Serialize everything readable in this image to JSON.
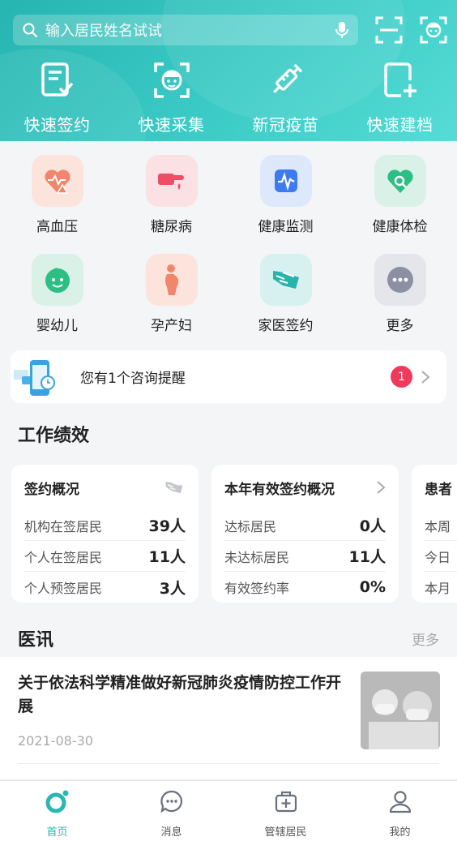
{
  "search": {
    "placeholder": "输入居民姓名试试",
    "icon": "search-icon",
    "mic_icon": "microphone-icon"
  },
  "header_icons": [
    "scan-icon",
    "face-scan-icon"
  ],
  "quick_actions": [
    {
      "label": "快速签约",
      "icon": "sign-document-icon"
    },
    {
      "label": "快速采集",
      "icon": "face-capture-icon"
    },
    {
      "label": "新冠疫苗",
      "icon": "vaccine-syringe-icon"
    },
    {
      "label": "快速建档",
      "icon": "new-file-icon"
    }
  ],
  "services": [
    {
      "label": "高血压",
      "icon": "heart-alert-icon",
      "tile_color": "#fce4dc"
    },
    {
      "label": "糖尿病",
      "icon": "finger-blood-icon",
      "tile_color": "#fbe0e4"
    },
    {
      "label": "健康监测",
      "icon": "heartbeat-monitor-icon",
      "tile_color": "#dde8fb"
    },
    {
      "label": "健康体检",
      "icon": "heart-search-icon",
      "tile_color": "#d9f1e6"
    },
    {
      "label": "婴幼儿",
      "icon": "baby-face-icon",
      "tile_color": "#d9f1e6"
    },
    {
      "label": "孕产妇",
      "icon": "pregnant-woman-icon",
      "tile_color": "#fce4dc"
    },
    {
      "label": "家医签约",
      "icon": "handshake-contract-icon",
      "tile_color": "#d6f1ef"
    },
    {
      "label": "更多",
      "icon": "more-dots-icon",
      "tile_color": "#e4e6ec"
    }
  ],
  "reminder": {
    "text": "您有1个咨询提醒",
    "badge": "1"
  },
  "performance": {
    "title": "工作绩效",
    "cards": [
      {
        "title": "签约概况",
        "rows": [
          {
            "label": "机构在签居民",
            "value": "39人"
          },
          {
            "label": "个人在签居民",
            "value": "11人"
          },
          {
            "label": "个人预签居民",
            "value": "3人"
          }
        ]
      },
      {
        "title": "本年有效签约概况",
        "rows": [
          {
            "label": "达标居民",
            "value": "0人"
          },
          {
            "label": "未达标居民",
            "value": "11人"
          },
          {
            "label": "有效签约率",
            "value": "0%"
          }
        ]
      },
      {
        "title": "患者",
        "rows": [
          {
            "label": "本周",
            "value": ""
          },
          {
            "label": "今日",
            "value": ""
          },
          {
            "label": "本月",
            "value": ""
          }
        ]
      }
    ]
  },
  "news": {
    "title": "医讯",
    "more": "更多",
    "items": [
      {
        "title": "关于依法科学精准做好新冠肺炎疫情防控工作开展",
        "date": "2021-08-30"
      }
    ]
  },
  "tabs": [
    {
      "label": "首页",
      "icon": "home-icon",
      "active": true
    },
    {
      "label": "消息",
      "icon": "message-icon",
      "active": false
    },
    {
      "label": "管辖居民",
      "icon": "medical-kit-icon",
      "active": false
    },
    {
      "label": "我的",
      "icon": "user-icon",
      "active": false
    }
  ],
  "colors": {
    "brand": "#2bb6b1",
    "badge": "#ef3a5d"
  }
}
